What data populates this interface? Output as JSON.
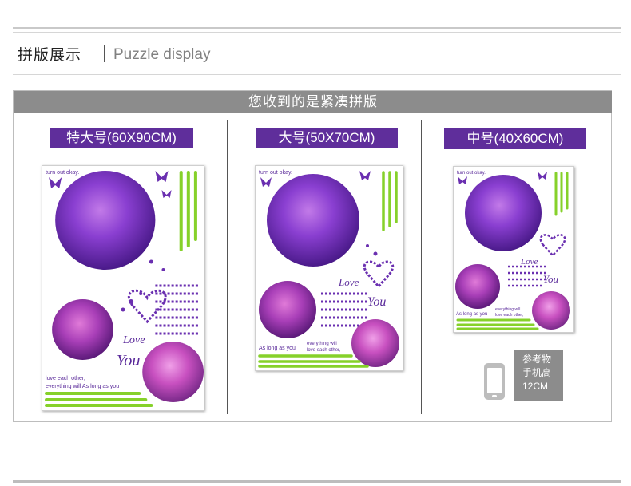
{
  "header": {
    "title_cn": "拼版展示",
    "title_en": "Puzzle display"
  },
  "banner": {
    "text": "您收到的是紧凑拼版"
  },
  "sizes": [
    {
      "label": "特大号(60X90CM)"
    },
    {
      "label": "大号(50X70CM)"
    },
    {
      "label": "中号(40X60CM)"
    }
  ],
  "sticker_text": {
    "top": "turn out okay.",
    "love": "Love",
    "you": "You",
    "line1": "love each other,",
    "line2": "everything will As long as you",
    "alt1": "As long as you",
    "alt2": "everything will",
    "alt3": "love each other,"
  },
  "reference": {
    "line1": "参考物",
    "line2": "手机高",
    "line3": "12CM"
  },
  "icons": {
    "phone": "phone-icon"
  },
  "colors": {
    "accent_purple": "#5f2e9b",
    "banner_gray": "#8c8c8c",
    "leaf_green": "#86d12a"
  }
}
